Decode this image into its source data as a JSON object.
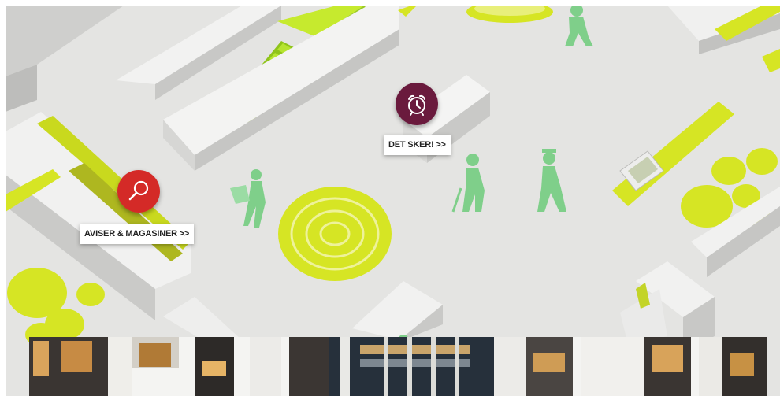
{
  "map": {
    "pois": [
      {
        "id": "aviser",
        "label": "AVISER & MAGASINER >>",
        "icon": "magnifier-icon",
        "color": "#d42a27"
      },
      {
        "id": "det-sker",
        "label": "DET SKER! >>",
        "icon": "alarm-clock-icon",
        "color": "#6a1a3d"
      }
    ],
    "colors": {
      "floor": "#e4e4e2",
      "accent_yellow": "#d6e524",
      "stair_green": "#a8dc22",
      "figure_green": "#7fcf8a"
    }
  },
  "photo": {
    "description_icon": "library-atrium-photo"
  }
}
